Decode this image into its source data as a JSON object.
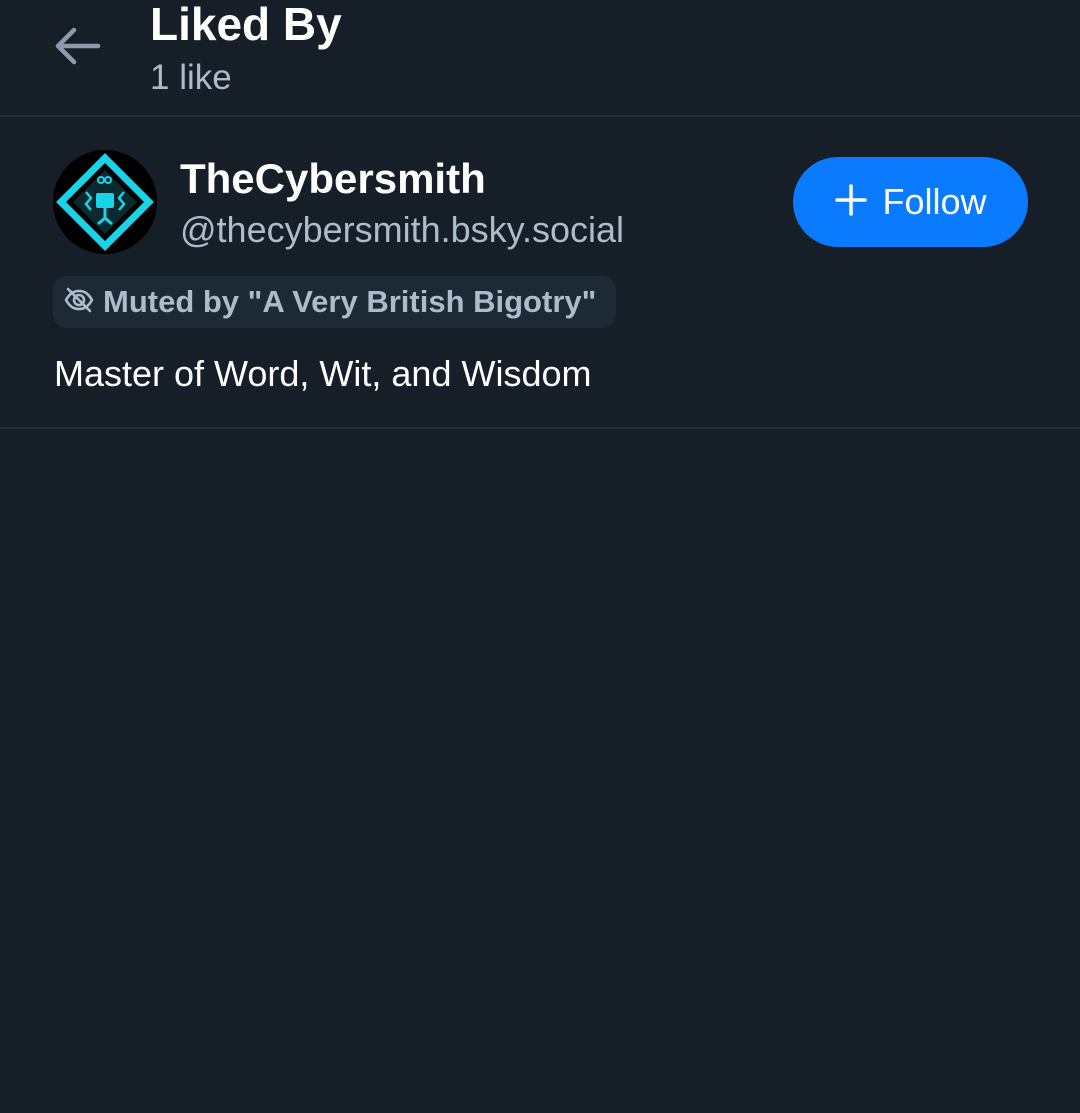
{
  "header": {
    "title": "Liked By",
    "subtitle": "1 like",
    "back_icon": "arrow-left-icon"
  },
  "colors": {
    "background": "#161e27",
    "divider": "#242e3a",
    "secondary_text": "#aebbc9",
    "accent": "#0a7aff",
    "badge_bg": "#1e2936",
    "avatar_accent": "#19d3e6"
  },
  "users": [
    {
      "display_name": "TheCybersmith",
      "handle": "@thecybersmith.bsky.social",
      "follow_label": "Follow",
      "follow_icon": "plus-icon",
      "muted_label": "Muted by \"A Very British Bigotry\"",
      "muted_icon": "eye-slash-icon",
      "bio": "Master of Word, Wit, and Wisdom"
    }
  ]
}
